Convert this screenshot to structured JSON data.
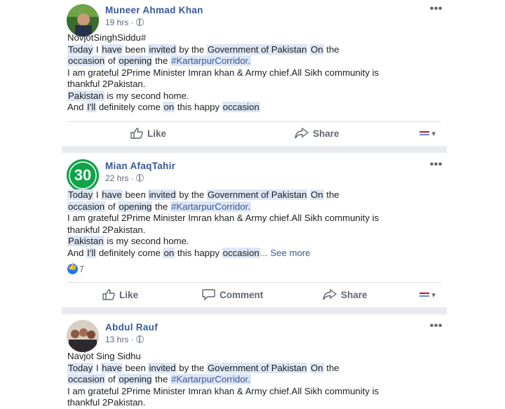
{
  "posts": [
    {
      "author": "Muneer Ahmad Khan",
      "time": "19 hrs",
      "lines": [
        [
          {
            "t": "NovjotSinghSiddu#",
            "hl": false
          }
        ],
        [
          {
            "t": "Today",
            "hl": true
          },
          {
            "t": " I ",
            "hl": false
          },
          {
            "t": "have",
            "hl": true
          },
          {
            "t": " been ",
            "hl": false
          },
          {
            "t": "invited",
            "hl": true
          },
          {
            "t": " by the ",
            "hl": false
          },
          {
            "t": "Government of Pakistan",
            "hl": true
          },
          {
            "t": " ",
            "hl": false
          },
          {
            "t": "On",
            "hl": true
          },
          {
            "t": " the",
            "hl": false
          }
        ],
        [
          {
            "t": "occasion",
            "hl": true
          },
          {
            "t": " of ",
            "hl": false
          },
          {
            "t": "opening",
            "hl": true
          },
          {
            "t": " the ",
            "hl": false
          },
          {
            "t": "#KartarpurCorridor.",
            "hl": "blue"
          }
        ],
        [
          {
            "t": "I am grateful 2Prime Minister Imran khan & Army chief.All Sikh community is",
            "hl": false
          }
        ],
        [
          {
            "t": "thankful 2Pakistan.",
            "hl": false
          }
        ],
        [
          {
            "t": "Pakistan",
            "hl": true
          },
          {
            "t": " is my second home.",
            "hl": false
          }
        ],
        [
          {
            "t": "And ",
            "hl": false
          },
          {
            "t": "I'll",
            "hl": true
          },
          {
            "t": " definitely come ",
            "hl": false
          },
          {
            "t": "on",
            "hl": true
          },
          {
            "t": " this happy ",
            "hl": false
          },
          {
            "t": "occasion",
            "hl": true
          }
        ]
      ],
      "actions": {
        "like": "Like",
        "share": "Share"
      }
    },
    {
      "author": "Mian AfaqTahir",
      "time": "22 hrs",
      "lines": [
        [
          {
            "t": "Today",
            "hl": true
          },
          {
            "t": " I ",
            "hl": false
          },
          {
            "t": "have",
            "hl": true
          },
          {
            "t": " been ",
            "hl": false
          },
          {
            "t": "invited",
            "hl": true
          },
          {
            "t": " by the ",
            "hl": false
          },
          {
            "t": "Government of Pakistan",
            "hl": true
          },
          {
            "t": " ",
            "hl": false
          },
          {
            "t": "On",
            "hl": true
          },
          {
            "t": " the",
            "hl": false
          }
        ],
        [
          {
            "t": "occasion",
            "hl": true
          },
          {
            "t": " of ",
            "hl": false
          },
          {
            "t": "opening",
            "hl": true
          },
          {
            "t": " the ",
            "hl": false
          },
          {
            "t": "#KartarpurCorridor.",
            "hl": "blue"
          }
        ],
        [
          {
            "t": "I am grateful 2Prime Minister Imran khan & Army chief.All Sikh community is",
            "hl": false
          }
        ],
        [
          {
            "t": "thankful 2Pakistan.",
            "hl": false
          }
        ],
        [
          {
            "t": "Pakistan",
            "hl": true
          },
          {
            "t": " is my second home.",
            "hl": false
          }
        ],
        [
          {
            "t": "And ",
            "hl": false
          },
          {
            "t": "I'll",
            "hl": true
          },
          {
            "t": " definitely come ",
            "hl": false
          },
          {
            "t": "on",
            "hl": true
          },
          {
            "t": " this happy ",
            "hl": false
          },
          {
            "t": "occasion",
            "hl": true
          },
          {
            "t": "... See more",
            "hl": "more"
          }
        ]
      ],
      "avatar_text": "30",
      "like_count": "7",
      "actions": {
        "like": "Like",
        "comment": "Comment",
        "share": "Share"
      }
    },
    {
      "author": "Abdul Rauf",
      "time": "13 hrs",
      "lines": [
        [
          {
            "t": "Navjot Sing Sidhu",
            "hl": false
          }
        ],
        [
          {
            "t": "Today",
            "hl": true
          },
          {
            "t": " I ",
            "hl": false
          },
          {
            "t": "have",
            "hl": true
          },
          {
            "t": " been ",
            "hl": false
          },
          {
            "t": "invited",
            "hl": true
          },
          {
            "t": " by the ",
            "hl": false
          },
          {
            "t": "Government of Pakistan",
            "hl": true
          },
          {
            "t": " ",
            "hl": false
          },
          {
            "t": "On",
            "hl": true
          },
          {
            "t": " the",
            "hl": false
          }
        ],
        [
          {
            "t": "occasion",
            "hl": true
          },
          {
            "t": " of ",
            "hl": false
          },
          {
            "t": "opening",
            "hl": true
          },
          {
            "t": " the ",
            "hl": false
          },
          {
            "t": "#KartarpurCorridor.",
            "hl": "blue"
          }
        ],
        [
          {
            "t": "I am grateful 2Prime Minister Imran khan & Army chief.All Sikh community is",
            "hl": false
          }
        ],
        [
          {
            "t": "thankful 2Pakistan.",
            "hl": false
          }
        ]
      ]
    }
  ],
  "dots": "•••",
  "colors": {
    "link": "#385898",
    "highlight": "#dde6f5",
    "separator": "#e9ebee",
    "like_badge": "#2078f4"
  }
}
